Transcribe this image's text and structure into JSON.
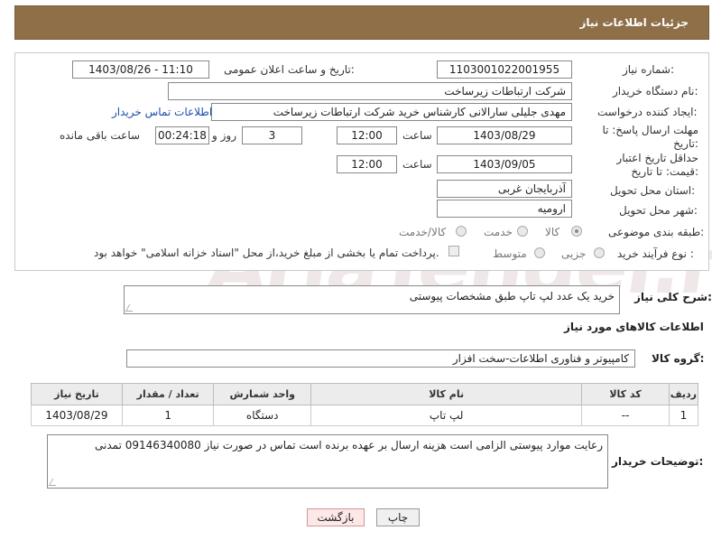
{
  "header": {
    "title": "جزئیات اطلاعات نیاز"
  },
  "form": {
    "need_number_label": "شماره نیاز:",
    "need_number": "1103001022001955",
    "announce_label": "تاریخ و ساعت اعلان عمومی:",
    "announce_value": "1403/08/26 - 11:10",
    "buyer_org_label": "نام دستگاه خریدار:",
    "buyer_org": "شرکت ارتباطات زیرساخت",
    "creator_label": "ایجاد کننده درخواست:",
    "creator": "مهدی جلیلی سارالانی کارشناس خرید شرکت ارتباطات زیرساخت",
    "contact_link": "اطلاعات تماس خریدار",
    "reply_deadline_label": "مهلت ارسال پاسخ: تا تاریخ:",
    "reply_date": "1403/08/29",
    "time_label": "ساعت",
    "reply_time": "12:00",
    "days_value": "3",
    "days_label": "روز و",
    "remaining_time": "00:24:18",
    "remaining_label": "ساعت باقی مانده",
    "min_validity_label": "حداقل تاریخ اعتبار قیمت: تا تاریخ:",
    "validity_date": "1403/09/05",
    "validity_time": "12:00",
    "province_label": "استان محل تحویل:",
    "province": "آذربایجان غربی",
    "city_label": "شهر محل تحویل:",
    "city": "ارومیه",
    "category_label": "طبقه بندی موضوعی:",
    "category_goods": "کالا",
    "category_service": "خدمت",
    "category_both": "کالا/خدمت",
    "process_label": "نوع فرآیند خرید :",
    "process_minor": "جزیی",
    "process_medium": "متوسط",
    "payment_note": "پرداخت تمام یا بخشی از مبلغ خرید،از محل \"اسناد خزانه اسلامی\" خواهد بود."
  },
  "summary": {
    "label": "شرح کلی نیاز:",
    "text": "خرید یک عدد لپ تاپ طبق مشخصات پیوستی"
  },
  "goods": {
    "section_title": "اطلاعات کالاهای مورد نیاز",
    "group_label": "گروه کالا:",
    "group_value": "کامپیوتر و فناوری اطلاعات-سخت افزار",
    "columns": [
      "ردیف",
      "کد کالا",
      "نام کالا",
      "واحد شمارش",
      "تعداد / مقدار",
      "تاریخ نیاز"
    ],
    "rows": [
      {
        "row": "1",
        "code": "--",
        "name": "لپ تاپ",
        "unit": "دستگاه",
        "qty": "1",
        "date": "1403/08/29"
      }
    ]
  },
  "buyer_notes": {
    "label": "توضیحات خریدار:",
    "text": "رعایت موارد پیوستی الزامی است هزینه ارسال بر عهده برنده است تماس در صورت نیاز 09146340080 تمدنی"
  },
  "buttons": {
    "print": "چاپ",
    "back": "بازگشت"
  },
  "watermark": "AriaTender.neT"
}
